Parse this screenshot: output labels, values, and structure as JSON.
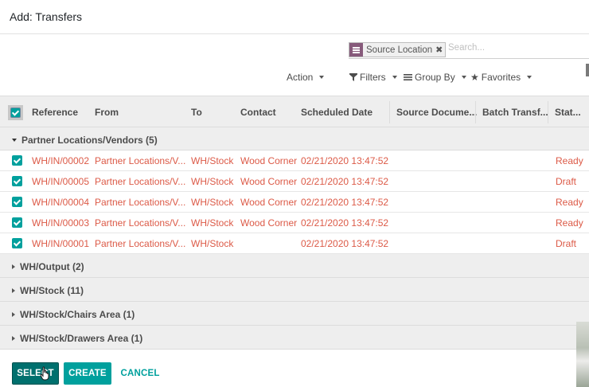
{
  "dialog": {
    "title": "Add: Transfers"
  },
  "search": {
    "facet_value": "Source Location",
    "placeholder": "Search...",
    "facet_icon": "filter-group-icon",
    "remove_icon": "close-icon"
  },
  "toolbar": {
    "action": "Action",
    "filters": "Filters",
    "group_by": "Group By",
    "favorites": "Favorites",
    "filters_icon": "funnel-icon",
    "group_by_icon": "list-icon",
    "favorites_icon": "star-icon"
  },
  "table": {
    "columns": [
      "Reference",
      "From",
      "To",
      "Contact",
      "Scheduled Date",
      "Source Docume...",
      "Batch Transf...",
      "Stat..."
    ],
    "open_group": {
      "label": "Partner Locations/Vendors (5)",
      "rows": [
        {
          "reference": "WH/IN/00002",
          "from": "Partner Locations/V...",
          "to": "WH/Stock",
          "contact": "Wood Corner",
          "date": "02/21/2020 13:47:52",
          "status": "Ready"
        },
        {
          "reference": "WH/IN/00005",
          "from": "Partner Locations/V...",
          "to": "WH/Stock",
          "contact": "Wood Corner",
          "date": "02/21/2020 13:47:52",
          "status": "Draft"
        },
        {
          "reference": "WH/IN/00004",
          "from": "Partner Locations/V...",
          "to": "WH/Stock",
          "contact": "Wood Corner",
          "date": "02/21/2020 13:47:52",
          "status": "Ready"
        },
        {
          "reference": "WH/IN/00003",
          "from": "Partner Locations/V...",
          "to": "WH/Stock",
          "contact": "Wood Corner",
          "date": "02/21/2020 13:47:52",
          "status": "Ready"
        },
        {
          "reference": "WH/IN/00001",
          "from": "Partner Locations/V...",
          "to": "WH/Stock",
          "contact": "",
          "date": "02/21/2020 13:47:52",
          "status": "Draft"
        }
      ]
    },
    "collapsed_groups": [
      "WH/Output (2)",
      "WH/Stock (11)",
      "WH/Stock/Chairs Area (1)",
      "WH/Stock/Drawers Area (1)"
    ]
  },
  "footer": {
    "select": "SELECT",
    "create": "CREATE",
    "cancel": "CANCEL"
  },
  "colors": {
    "primary": "#00a09d",
    "primary_dark": "#00706e",
    "row_text": "#dc5a47",
    "facet": "#875a7b",
    "header_bg": "#eeeeee"
  }
}
